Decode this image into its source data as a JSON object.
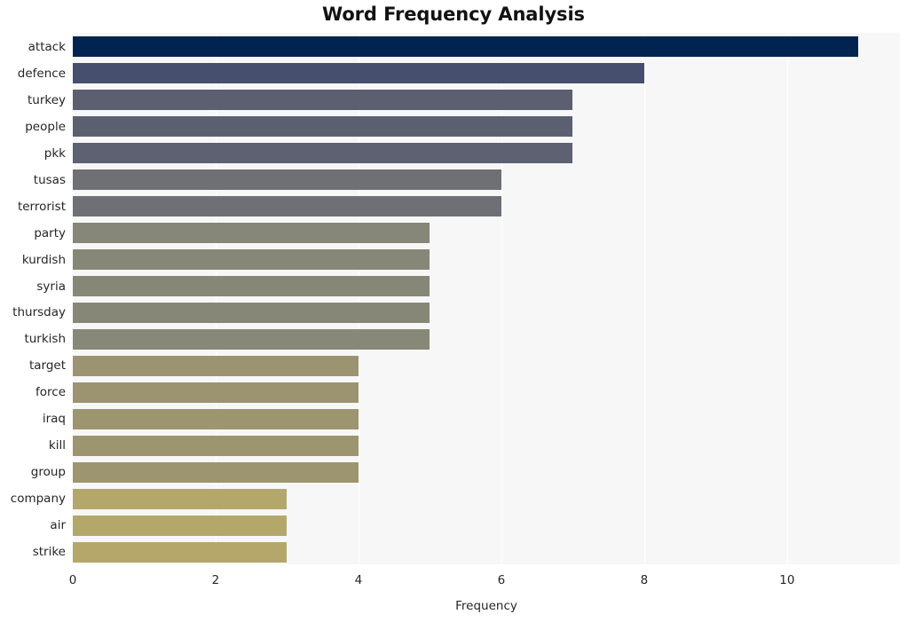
{
  "chart_data": {
    "type": "bar",
    "orientation": "horizontal",
    "title": "Word Frequency Analysis",
    "xlabel": "Frequency",
    "ylabel": "",
    "xlim": [
      0,
      11.58
    ],
    "xticks": [
      0,
      2,
      4,
      6,
      8,
      10
    ],
    "xtick_labels": [
      "0",
      "2",
      "4",
      "6",
      "8",
      "10"
    ],
    "grid": "vertical",
    "legend": "none",
    "categories": [
      "attack",
      "defence",
      "turkey",
      "people",
      "pkk",
      "tusas",
      "terrorist",
      "party",
      "kurdish",
      "syria",
      "thursday",
      "turkish",
      "target",
      "force",
      "iraq",
      "kill",
      "group",
      "company",
      "air",
      "strike"
    ],
    "values": [
      11,
      8,
      7,
      7,
      7,
      6,
      6,
      5,
      5,
      5,
      5,
      5,
      4,
      4,
      4,
      4,
      4,
      3,
      3,
      3
    ],
    "bar_colors": [
      "#00244f",
      "#474f6f",
      "#5b5f70",
      "#5b6071",
      "#5d6171",
      "#6f7074",
      "#6f7075",
      "#868679",
      "#878778",
      "#878778",
      "#878778",
      "#888878",
      "#9c9471",
      "#9c9471",
      "#9d9570",
      "#9d9570",
      "#9d9570",
      "#b3a76b",
      "#b4a76a",
      "#b5a76a"
    ],
    "plot_background": "#f7f7f7",
    "figure_background": "#ffffff",
    "gridline_color": "#ffffff",
    "title_color": "#121212",
    "tick_color": "#262626"
  }
}
